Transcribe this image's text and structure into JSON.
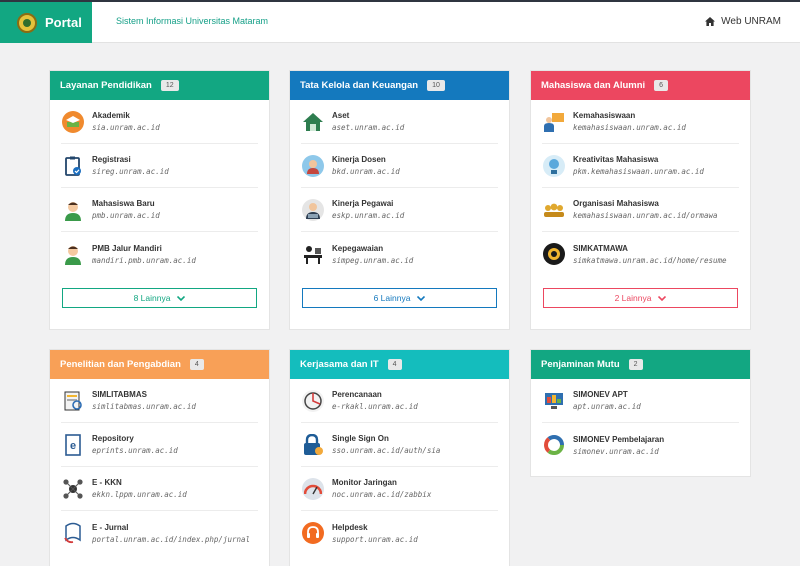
{
  "header": {
    "brand": "Portal",
    "subtitle": "Sistem Informasi Universitas Mataram",
    "web_link": "Web UNRAM"
  },
  "colors": {
    "green": "#12a782",
    "blue": "#1479be",
    "red": "#ec4760",
    "orange": "#f8a057",
    "teal": "#14bdbd"
  },
  "cards": [
    {
      "title": "Layanan Pendidikan",
      "count": "12",
      "more": "8 Lainnya",
      "items": [
        {
          "name": "Akademik",
          "url": "sia.unram.ac.id",
          "icon": "academic-icon"
        },
        {
          "name": "Registrasi",
          "url": "sireg.unram.ac.id",
          "icon": "clipboard-check-icon"
        },
        {
          "name": "Mahasiswa Baru",
          "url": "pmb.unram.ac.id",
          "icon": "student-icon"
        },
        {
          "name": "PMB Jalur Mandiri",
          "url": "mandiri.pmb.unram.ac.id",
          "icon": "student-icon"
        }
      ]
    },
    {
      "title": "Tata Kelola dan Keuangan",
      "count": "10",
      "more": "6 Lainnya",
      "items": [
        {
          "name": "Aset",
          "url": "aset.unram.ac.id",
          "icon": "house-icon"
        },
        {
          "name": "Kinerja Dosen",
          "url": "bkd.unram.ac.id",
          "icon": "lecturer-icon"
        },
        {
          "name": "Kinerja Pegawai",
          "url": "eskp.unram.ac.id",
          "icon": "employee-icon"
        },
        {
          "name": "Kepegawaian",
          "url": "simpeg.unram.ac.id",
          "icon": "desk-icon"
        }
      ]
    },
    {
      "title": "Mahasiswa dan Alumni",
      "count": "6",
      "more": "2 Lainnya",
      "items": [
        {
          "name": "Kemahasiswaan",
          "url": "kemahasiswaan.unram.ac.id",
          "icon": "presentation-icon"
        },
        {
          "name": "Kreativitas Mahasiswa",
          "url": "pkm.kemahasiswaan.unram.ac.id",
          "icon": "idea-icon"
        },
        {
          "name": "Organisasi Mahasiswa",
          "url": "kemahasiswaan.unram.ac.id/ormawa",
          "icon": "group-icon"
        },
        {
          "name": "SIMKATMAWA",
          "url": "simkatmawa.unram.ac.id/home/resume",
          "icon": "medal-icon"
        }
      ]
    },
    {
      "title": "Penelitian dan Pengabdian",
      "count": "4",
      "items": [
        {
          "name": "SIMLITABMAS",
          "url": "simlitabmas.unram.ac.id",
          "icon": "research-icon"
        },
        {
          "name": "Repository",
          "url": "eprints.unram.ac.id",
          "icon": "document-icon"
        },
        {
          "name": "E - KKN",
          "url": "ekkn.lppm.unram.ac.id",
          "icon": "network-icon"
        },
        {
          "name": "E - Jurnal",
          "url": "portal.unram.ac.id/index.php/jurnal",
          "icon": "journal-icon"
        }
      ]
    },
    {
      "title": "Kerjasama dan IT",
      "count": "4",
      "items": [
        {
          "name": "Perencanaan",
          "url": "e-rkakl.unram.ac.id",
          "icon": "planning-icon"
        },
        {
          "name": "Single Sign On",
          "url": "sso.unram.ac.id/auth/sia",
          "icon": "lock-icon"
        },
        {
          "name": "Monitor Jaringan",
          "url": "noc.unram.ac.id/zabbix",
          "icon": "gauge-icon"
        },
        {
          "name": "Helpdesk",
          "url": "support.unram.ac.id",
          "icon": "headset-icon"
        }
      ]
    },
    {
      "title": "Penjaminan Mutu",
      "count": "2",
      "items": [
        {
          "name": "SIMONEV APT",
          "url": "apt.unram.ac.id",
          "icon": "monitor-icon"
        },
        {
          "name": "SIMONEV Pembelajaran",
          "url": "simonev.unram.ac.id",
          "icon": "chart-ring-icon"
        }
      ]
    }
  ]
}
